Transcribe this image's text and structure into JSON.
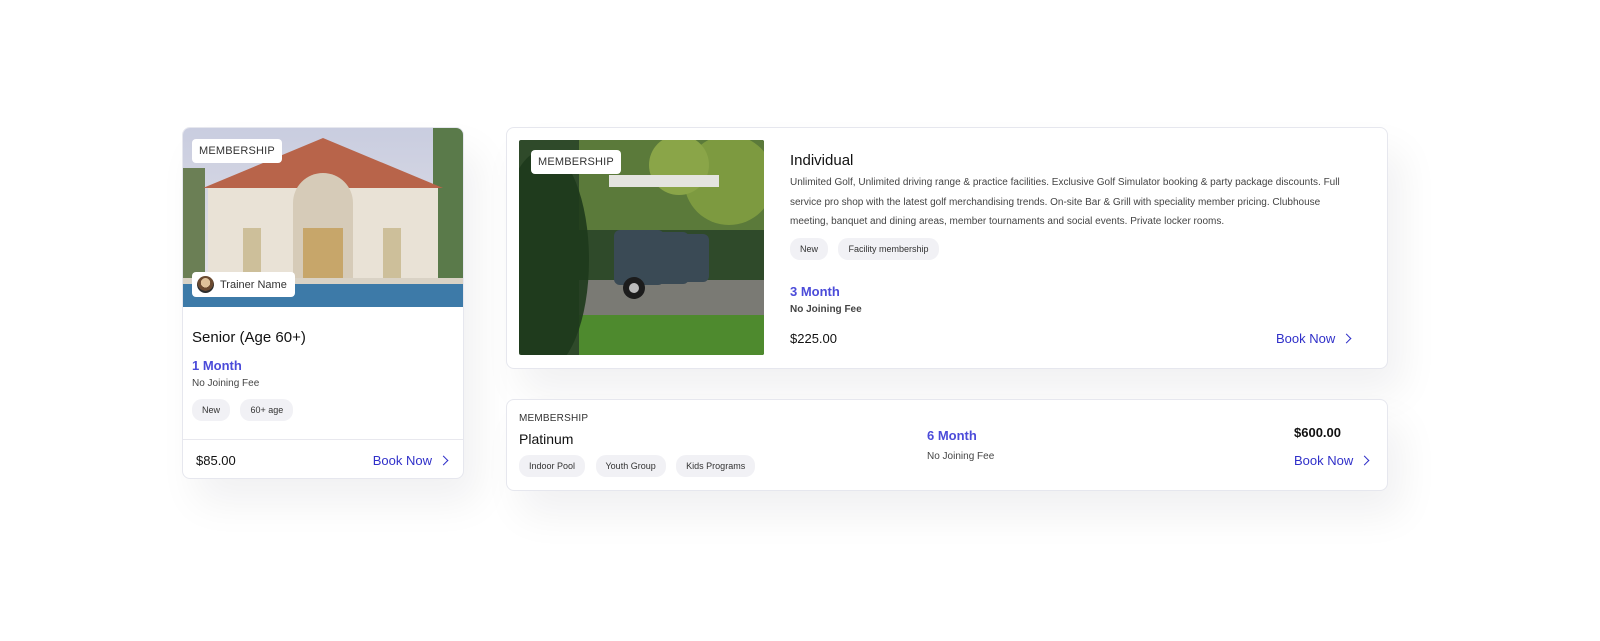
{
  "cards": {
    "senior": {
      "badge": "MEMBERSHIP",
      "trainer": "Trainer Name",
      "title": "Senior (Age 60+)",
      "period": "1 Month",
      "fee": "No Joining Fee",
      "tags": [
        "New",
        "60+ age"
      ],
      "price": "$85.00",
      "book": "Book Now"
    },
    "individual": {
      "badge": "MEMBERSHIP",
      "title": "Individual",
      "description": "Unlimited Golf, Unlimited driving range & practice facilities. Exclusive Golf Simulator booking & party package discounts. Full service pro shop with the latest golf merchandising trends. On-site Bar & Grill with speciality member pricing. Clubhouse meeting, banquet and dining areas, member tournaments and social events. Private locker rooms.",
      "tags": [
        "New",
        "Facility membership"
      ],
      "period": "3 Month",
      "fee": "No Joining Fee",
      "price": "$225.00",
      "book": "Book Now"
    },
    "platinum": {
      "category": "MEMBERSHIP",
      "title": "Platinum",
      "tags": [
        "Indoor Pool",
        "Youth Group",
        "Kids Programs"
      ],
      "period": "6 Month",
      "fee": "No Joining Fee",
      "price": "$600.00",
      "book": "Book Now"
    }
  },
  "colors": {
    "accent": "#4b4bd9",
    "link": "#3030c9"
  }
}
